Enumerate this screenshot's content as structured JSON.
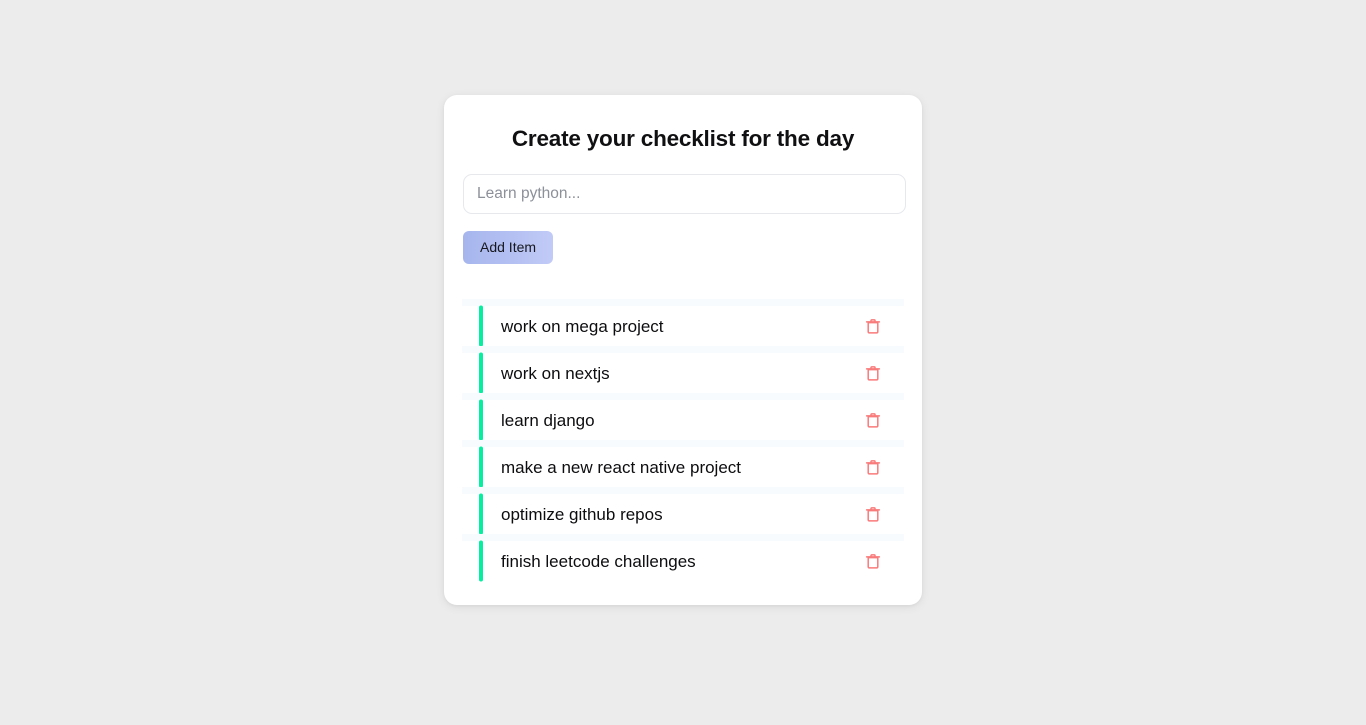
{
  "page": {
    "background_color": "#ececec"
  },
  "card": {
    "title": "Create your checklist for the day",
    "background_color": "#ffffff",
    "input": {
      "placeholder": "Learn python...",
      "value": ""
    },
    "add_button": {
      "label": "Add Item",
      "gradient_from": "#a6b6ed",
      "gradient_to": "#c2cbf7",
      "text_color": "#16181d"
    },
    "list": {
      "accent_color": "#05efa0",
      "delete_icon_color": "#f97a7a",
      "delete_icon_name": "trash-icon",
      "item_count": 6,
      "items": [
        {
          "label": "work on mega project"
        },
        {
          "label": "work on nextjs"
        },
        {
          "label": "learn django"
        },
        {
          "label": "make a new react native project"
        },
        {
          "label": "optimize github repos"
        },
        {
          "label": "finish leetcode challenges"
        }
      ]
    }
  }
}
